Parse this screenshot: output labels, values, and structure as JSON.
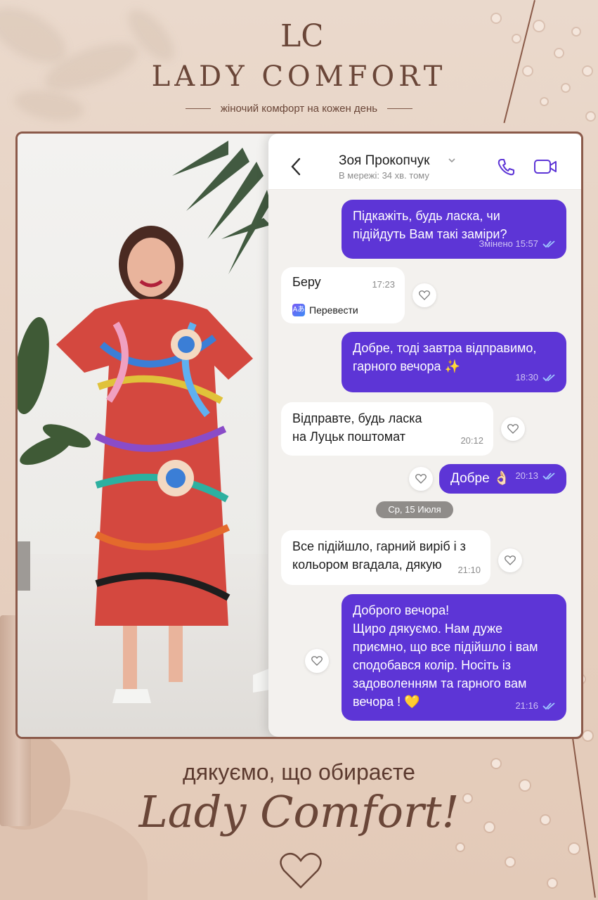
{
  "header": {
    "monogram": "LC",
    "brand": "LADY COMFORT",
    "tagline": "жіночий комфорт на кожен день"
  },
  "chat": {
    "contact_name": "Зоя Прокопчук",
    "status": "В мережі: 34 хв. тому",
    "date_divider": "Ср, 15 Июля",
    "translate_label": "Перевести",
    "messages": [
      {
        "direction": "out",
        "text": "Підкажіть, будь ласка, чи\nпідійдуть Вам такі заміри?",
        "time": "Змінено 15:57"
      },
      {
        "direction": "in",
        "text": "Беру",
        "time": "17:23"
      },
      {
        "direction": "out",
        "text": "Добре, тоді завтра відправимо,\nгарного вечора ✨",
        "time": "18:30"
      },
      {
        "direction": "in",
        "text": "Відправте, будь ласка\nна Луцьк поштомат",
        "time": "20:12"
      },
      {
        "direction": "out",
        "text": "Добре 👌🏻",
        "time": "20:13"
      },
      {
        "direction": "in",
        "text": "Все підійшло, гарний виріб і з\nкольором вгадала, дякую",
        "time": "21:10"
      },
      {
        "direction": "out",
        "text": "Доброго вечора!\nЩиро дякуємо. Нам дуже\nприємно, що все підійшло і вам\nсподобався колір. Носіть із\nзадоволенням та гарного вам\nвечора ! 💛",
        "time": "21:16"
      }
    ]
  },
  "footer": {
    "line1": "дякуємо, що обираєте",
    "line2": "Lady Comfort!"
  },
  "icons": [
    "back-icon",
    "chevron-down-icon",
    "phone-icon",
    "video-camera-icon",
    "heart-icon",
    "double-check-icon",
    "translate-icon"
  ],
  "colors": {
    "accent": "#5d35d6",
    "brand": "#6a4638",
    "frame": "#8b5a4a"
  }
}
